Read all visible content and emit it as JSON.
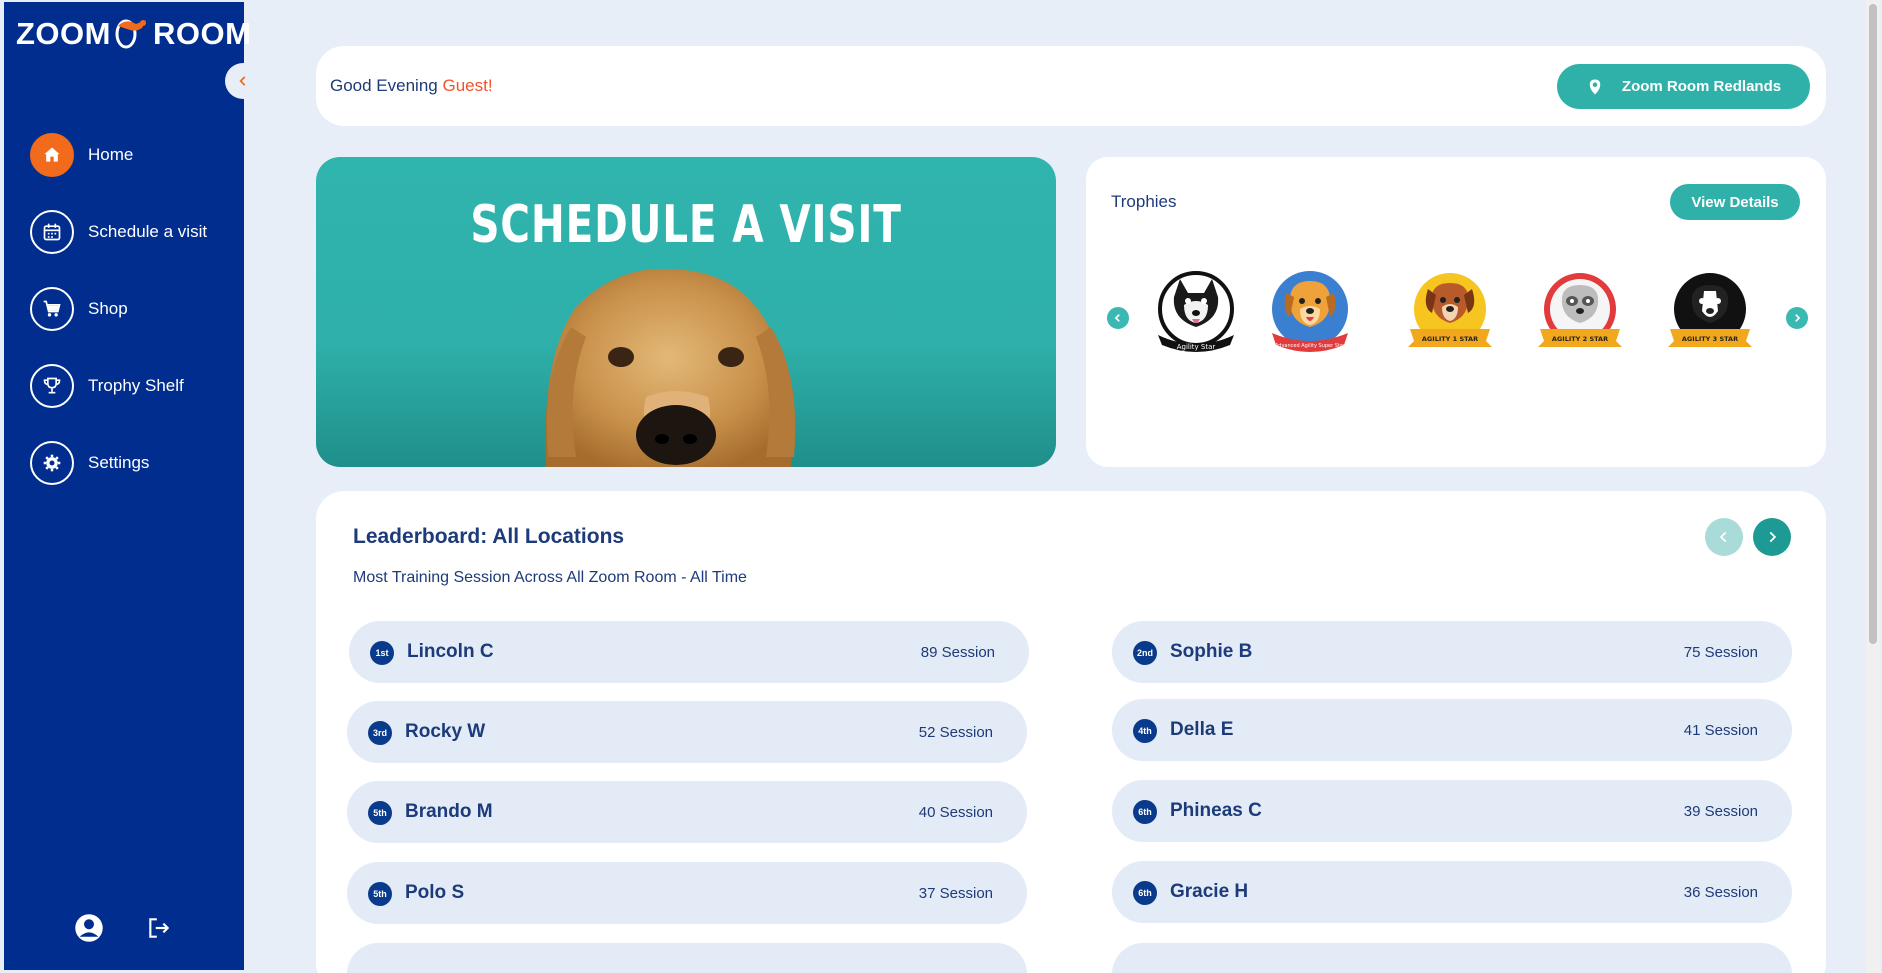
{
  "sidebar": {
    "logo_left": "ZOOM",
    "logo_right": "ROOM",
    "items": [
      {
        "label": "Home",
        "icon": "home-icon",
        "active": true
      },
      {
        "label": "Schedule a visit",
        "icon": "calendar-icon"
      },
      {
        "label": "Shop",
        "icon": "cart-icon"
      },
      {
        "label": "Trophy Shelf",
        "icon": "trophy-icon"
      },
      {
        "label": "Settings",
        "icon": "gear-icon"
      }
    ]
  },
  "header": {
    "greeting": "Good Evening ",
    "user": "Guest!",
    "location_label": "Zoom Room Redlands"
  },
  "hero": {
    "title": "SCHEDULE A VISIT"
  },
  "trophies": {
    "title": "Trophies",
    "view_details_label": "View Details",
    "badges": [
      {
        "label": "Agility Star",
        "color": "#111111"
      },
      {
        "label": "Advanced Agility Super Star",
        "color": "#3b7fd1"
      },
      {
        "label": "AGILITY 1 STAR",
        "color": "#f7c520"
      },
      {
        "label": "AGILITY 2 STAR",
        "color": "#e23b3b"
      },
      {
        "label": "AGILITY 3 STAR",
        "color": "#111111"
      }
    ]
  },
  "leaderboard": {
    "title": "Leaderboard: All Locations",
    "subtitle": "Most Training Session Across All Zoom Room - All Time",
    "entries": [
      {
        "rank": "1st",
        "name": "Lincoln C",
        "sessions": "89 Session"
      },
      {
        "rank": "2nd",
        "name": "Sophie B",
        "sessions": "75 Session"
      },
      {
        "rank": "3rd",
        "name": "Rocky W",
        "sessions": "52 Session"
      },
      {
        "rank": "4th",
        "name": "Della E",
        "sessions": "41 Session"
      },
      {
        "rank": "5th",
        "name": "Brando M",
        "sessions": "40 Session"
      },
      {
        "rank": "6th",
        "name": "Phineas C",
        "sessions": "39 Session"
      },
      {
        "rank": "5th",
        "name": "Polo S",
        "sessions": "37 Session"
      },
      {
        "rank": "6th",
        "name": "Gracie H",
        "sessions": "36 Session"
      }
    ]
  },
  "colors": {
    "sidebar": "#002d8e",
    "accent_teal": "#2fb1aa",
    "accent_orange": "#f26a1b",
    "text_navy": "#1d3a7a"
  }
}
